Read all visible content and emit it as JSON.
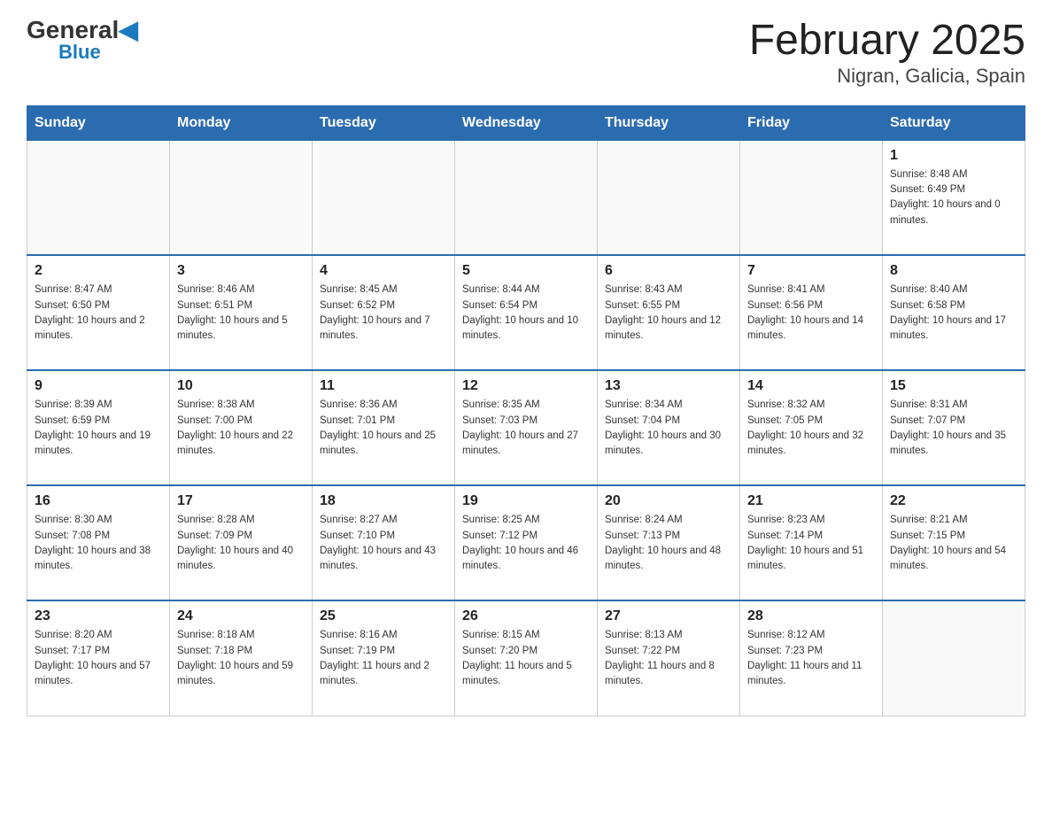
{
  "header": {
    "logo_general": "General",
    "logo_blue": "Blue",
    "title": "February 2025",
    "subtitle": "Nigran, Galicia, Spain"
  },
  "calendar": {
    "weekdays": [
      "Sunday",
      "Monday",
      "Tuesday",
      "Wednesday",
      "Thursday",
      "Friday",
      "Saturday"
    ],
    "weeks": [
      [
        {
          "day": "",
          "info": ""
        },
        {
          "day": "",
          "info": ""
        },
        {
          "day": "",
          "info": ""
        },
        {
          "day": "",
          "info": ""
        },
        {
          "day": "",
          "info": ""
        },
        {
          "day": "",
          "info": ""
        },
        {
          "day": "1",
          "info": "Sunrise: 8:48 AM\nSunset: 6:49 PM\nDaylight: 10 hours and 0 minutes."
        }
      ],
      [
        {
          "day": "2",
          "info": "Sunrise: 8:47 AM\nSunset: 6:50 PM\nDaylight: 10 hours and 2 minutes."
        },
        {
          "day": "3",
          "info": "Sunrise: 8:46 AM\nSunset: 6:51 PM\nDaylight: 10 hours and 5 minutes."
        },
        {
          "day": "4",
          "info": "Sunrise: 8:45 AM\nSunset: 6:52 PM\nDaylight: 10 hours and 7 minutes."
        },
        {
          "day": "5",
          "info": "Sunrise: 8:44 AM\nSunset: 6:54 PM\nDaylight: 10 hours and 10 minutes."
        },
        {
          "day": "6",
          "info": "Sunrise: 8:43 AM\nSunset: 6:55 PM\nDaylight: 10 hours and 12 minutes."
        },
        {
          "day": "7",
          "info": "Sunrise: 8:41 AM\nSunset: 6:56 PM\nDaylight: 10 hours and 14 minutes."
        },
        {
          "day": "8",
          "info": "Sunrise: 8:40 AM\nSunset: 6:58 PM\nDaylight: 10 hours and 17 minutes."
        }
      ],
      [
        {
          "day": "9",
          "info": "Sunrise: 8:39 AM\nSunset: 6:59 PM\nDaylight: 10 hours and 19 minutes."
        },
        {
          "day": "10",
          "info": "Sunrise: 8:38 AM\nSunset: 7:00 PM\nDaylight: 10 hours and 22 minutes."
        },
        {
          "day": "11",
          "info": "Sunrise: 8:36 AM\nSunset: 7:01 PM\nDaylight: 10 hours and 25 minutes."
        },
        {
          "day": "12",
          "info": "Sunrise: 8:35 AM\nSunset: 7:03 PM\nDaylight: 10 hours and 27 minutes."
        },
        {
          "day": "13",
          "info": "Sunrise: 8:34 AM\nSunset: 7:04 PM\nDaylight: 10 hours and 30 minutes."
        },
        {
          "day": "14",
          "info": "Sunrise: 8:32 AM\nSunset: 7:05 PM\nDaylight: 10 hours and 32 minutes."
        },
        {
          "day": "15",
          "info": "Sunrise: 8:31 AM\nSunset: 7:07 PM\nDaylight: 10 hours and 35 minutes."
        }
      ],
      [
        {
          "day": "16",
          "info": "Sunrise: 8:30 AM\nSunset: 7:08 PM\nDaylight: 10 hours and 38 minutes."
        },
        {
          "day": "17",
          "info": "Sunrise: 8:28 AM\nSunset: 7:09 PM\nDaylight: 10 hours and 40 minutes."
        },
        {
          "day": "18",
          "info": "Sunrise: 8:27 AM\nSunset: 7:10 PM\nDaylight: 10 hours and 43 minutes."
        },
        {
          "day": "19",
          "info": "Sunrise: 8:25 AM\nSunset: 7:12 PM\nDaylight: 10 hours and 46 minutes."
        },
        {
          "day": "20",
          "info": "Sunrise: 8:24 AM\nSunset: 7:13 PM\nDaylight: 10 hours and 48 minutes."
        },
        {
          "day": "21",
          "info": "Sunrise: 8:23 AM\nSunset: 7:14 PM\nDaylight: 10 hours and 51 minutes."
        },
        {
          "day": "22",
          "info": "Sunrise: 8:21 AM\nSunset: 7:15 PM\nDaylight: 10 hours and 54 minutes."
        }
      ],
      [
        {
          "day": "23",
          "info": "Sunrise: 8:20 AM\nSunset: 7:17 PM\nDaylight: 10 hours and 57 minutes."
        },
        {
          "day": "24",
          "info": "Sunrise: 8:18 AM\nSunset: 7:18 PM\nDaylight: 10 hours and 59 minutes."
        },
        {
          "day": "25",
          "info": "Sunrise: 8:16 AM\nSunset: 7:19 PM\nDaylight: 11 hours and 2 minutes."
        },
        {
          "day": "26",
          "info": "Sunrise: 8:15 AM\nSunset: 7:20 PM\nDaylight: 11 hours and 5 minutes."
        },
        {
          "day": "27",
          "info": "Sunrise: 8:13 AM\nSunset: 7:22 PM\nDaylight: 11 hours and 8 minutes."
        },
        {
          "day": "28",
          "info": "Sunrise: 8:12 AM\nSunset: 7:23 PM\nDaylight: 11 hours and 11 minutes."
        },
        {
          "day": "",
          "info": ""
        }
      ]
    ]
  }
}
